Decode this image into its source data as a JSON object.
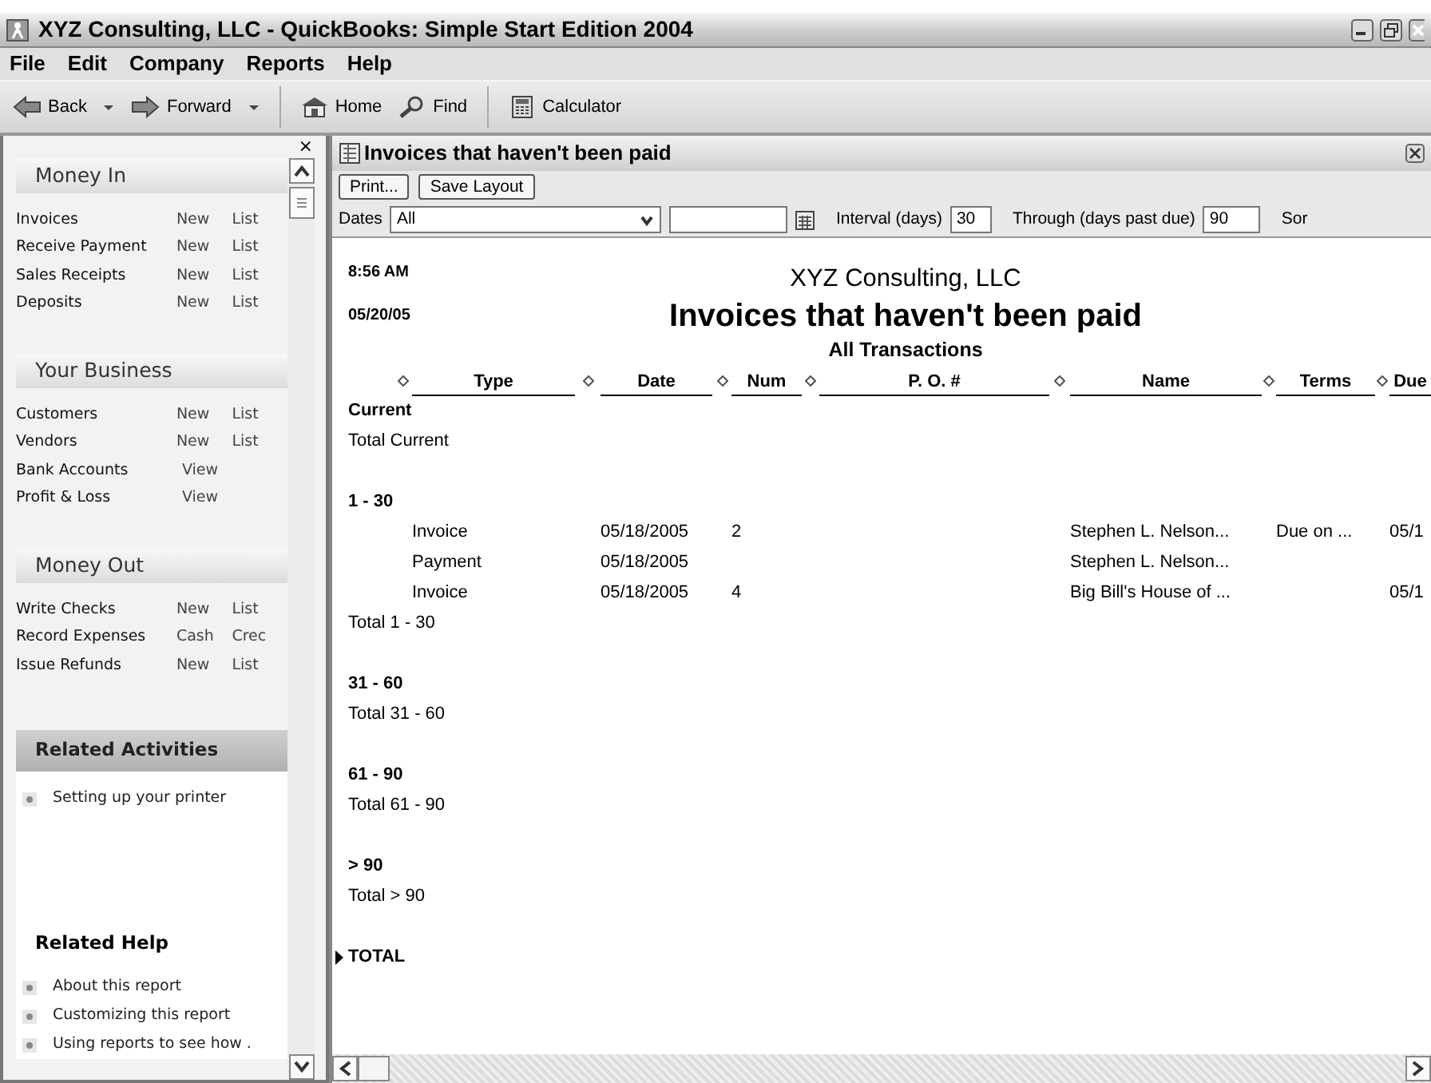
{
  "window": {
    "title": "XYZ Consulting, LLC - QuickBooks: Simple Start Edition 2004"
  },
  "menu": [
    "File",
    "Edit",
    "Company",
    "Reports",
    "Help"
  ],
  "toolbar": [
    {
      "kind": "back",
      "label": "Back",
      "dropdown": true
    },
    {
      "kind": "forward",
      "label": "Forward",
      "dropdown": true
    },
    {
      "kind": "home",
      "label": "Home",
      "dropdown": false
    },
    {
      "kind": "search",
      "label": "Find",
      "dropdown": false
    },
    {
      "kind": "calculator",
      "label": "Calculator",
      "dropdown": false
    }
  ],
  "sidebar": {
    "close_glyph": "×",
    "sections": [
      {
        "title": "Money In",
        "items": [
          {
            "label": "Invoices",
            "actions": [
              "New",
              "List"
            ]
          },
          {
            "label": "Receive Payment",
            "actions": [
              "New",
              "List"
            ]
          },
          {
            "label": "Sales Receipts",
            "actions": [
              "New",
              "List"
            ]
          },
          {
            "label": "Deposits",
            "actions": [
              "New",
              "List"
            ]
          }
        ]
      },
      {
        "title": "Your Business",
        "items": [
          {
            "label": "Customers",
            "actions": [
              "New",
              "List"
            ]
          },
          {
            "label": "Vendors",
            "actions": [
              "New",
              "List"
            ]
          },
          {
            "label": "Bank Accounts",
            "actions": [
              "View"
            ]
          },
          {
            "label": "Profit & Loss",
            "actions": [
              "View"
            ]
          }
        ]
      },
      {
        "title": "Money Out",
        "items": [
          {
            "label": "Write Checks",
            "actions": [
              "New",
              "List"
            ]
          },
          {
            "label": "Record Expenses",
            "actions": [
              "Cash",
              "Crec"
            ]
          },
          {
            "label": "Issue Refunds",
            "actions": [
              "New",
              "List"
            ]
          }
        ]
      }
    ],
    "related_activities": {
      "title": "Related Activities",
      "links": [
        "Setting up your printer"
      ]
    },
    "related_help": {
      "title": "Related Help",
      "links": [
        "About this report",
        "Customizing this report",
        "Using reports to see how ."
      ]
    }
  },
  "report_window": {
    "title": "Invoices that haven't been paid",
    "buttons": [
      "Print...",
      "Save Layout"
    ],
    "filters": {
      "dates_label": "Dates",
      "dates_value": "All",
      "interval_label": "Interval (days)",
      "interval_value": "30",
      "through_label": "Through (days past due)",
      "through_value": "90",
      "sort_label": "Sor"
    },
    "report": {
      "time": "8:56 AM",
      "date": "05/20/05",
      "company": "XYZ Consulting, LLC",
      "title": "Invoices that haven't been paid",
      "subtitle": "All Transactions",
      "columns": [
        "Type",
        "Date",
        "Num",
        "P. O. #",
        "Name",
        "Terms",
        "Due"
      ],
      "groups": [
        {
          "heading": "Current",
          "total": "Total Current"
        },
        {
          "heading": "1 - 30",
          "rows": [
            [
              "Invoice",
              "05/18/2005",
              "2",
              "",
              "Stephen L. Nelson...",
              "Due on ...",
              "05/1"
            ],
            [
              "Payment",
              "05/18/2005",
              "",
              "",
              "Stephen L. Nelson...",
              "",
              ""
            ],
            [
              "Invoice",
              "05/18/2005",
              "4",
              "",
              "Big Bill's House of ...",
              "",
              "05/1"
            ]
          ],
          "total": "Total 1 - 30"
        },
        {
          "heading": "31 - 60",
          "total": "Total 31 - 60"
        },
        {
          "heading": "61 - 90",
          "total": "Total 61 - 90"
        },
        {
          "heading": "> 90",
          "total": "Total > 90"
        }
      ],
      "grand_total": "TOTAL"
    }
  }
}
